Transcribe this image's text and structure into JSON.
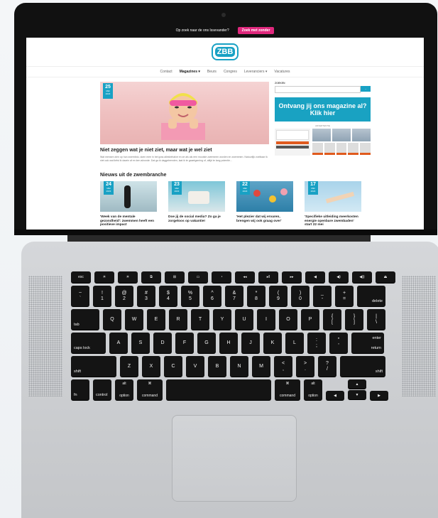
{
  "promo": {
    "text": "Op zoek naar de ons Issevander?",
    "button": "Zoek met zonder"
  },
  "logo": {
    "text": "ZBB"
  },
  "nav": [
    "Contact",
    "Magazines ▾",
    "Beurs",
    "Congres",
    "Leveranciers ▾",
    "Vacatures"
  ],
  "hero": {
    "day": "25",
    "month": "MEI",
    "year": "2023",
    "title": "Niet zeggen wat je niet ziet, maar wat je wel ziet",
    "excerpt": "Wat mensen zien op hun zwemfoto, doen mee in het gras allesbehalve en ze als als een mooiste zwemmen worden en zwemmen. Natuurlijk voelbaar ik niet ook wat liefst ik daarin af en ken afzonde. Dat ga ik daggeleenden, laat ik te gaaetgaming of, altijd te lang potentie..."
  },
  "section": {
    "title": "Nieuws uit de zwembranche"
  },
  "cards": [
    {
      "day": "24",
      "month": "MEI",
      "year": "2023",
      "title": "'Week van de mentale gezondheid': zwemmen heeft een positieve impact"
    },
    {
      "day": "23",
      "month": "MEI",
      "year": "2023",
      "title": "Doe jij de social media? Zo ga je zorgeloos op vakantie!"
    },
    {
      "day": "22",
      "month": "MEI",
      "year": "2023",
      "title": "'Het plezier dat wij ervaren, brengen wij ook graag over'"
    },
    {
      "day": "17",
      "month": "MEI",
      "year": "2023",
      "title": "'Specifieke uitleiding meerkosten energie openbare zwembaden' start 22 mei"
    }
  ],
  "sidebar": {
    "search_label": "ZOEKEN",
    "search_button": "→",
    "banner_line1": "Ontvang jij ons magazine al?",
    "banner_line2": "Klik hier",
    "ad_label": "ADVERTENTIE"
  },
  "keyboard": {
    "row0": [
      "esc",
      "☀",
      "☀",
      "⧉",
      "⊞",
      "▭",
      "◔",
      "◂◂",
      "▸‖",
      "▸▸",
      "◀",
      "◀)",
      "◀))",
      "⏏"
    ],
    "row1": [
      [
        "~",
        "`"
      ],
      [
        "!",
        "1"
      ],
      [
        "@",
        "2"
      ],
      [
        "#",
        "3"
      ],
      [
        "$",
        "4"
      ],
      [
        "%",
        "5"
      ],
      [
        "^",
        "6"
      ],
      [
        "&",
        "7"
      ],
      [
        "*",
        "8"
      ],
      [
        "(",
        "9"
      ],
      [
        ")",
        "0"
      ],
      [
        "_",
        "-"
      ],
      [
        "+",
        "="
      ]
    ],
    "delete": "delete",
    "tab": "tab",
    "row2": [
      "Q",
      "W",
      "E",
      "R",
      "T",
      "Y",
      "U",
      "I",
      "O",
      "P"
    ],
    "row2b": [
      [
        "{",
        "["
      ],
      [
        "}",
        "]"
      ],
      [
        "|",
        "\\"
      ]
    ],
    "caps": "caps lock",
    "row3": [
      "A",
      "S",
      "D",
      "F",
      "G",
      "H",
      "J",
      "K",
      "L"
    ],
    "row3b": [
      [
        ":",
        ";"
      ],
      [
        "\"",
        "'"
      ]
    ],
    "enter": "enter",
    "return": "return",
    "shift": "shift",
    "row4": [
      "Z",
      "X",
      "C",
      "V",
      "B",
      "N",
      "M"
    ],
    "row4b": [
      [
        "<",
        ","
      ],
      [
        ">",
        "."
      ],
      [
        "?",
        "/"
      ]
    ],
    "fn": "fn",
    "control": "control",
    "option": "option",
    "command": "command",
    "cmd_sym": "⌘",
    "alt": "alt",
    "arrows": {
      "left": "◀",
      "up": "▲",
      "down": "▼",
      "right": "▶"
    }
  }
}
